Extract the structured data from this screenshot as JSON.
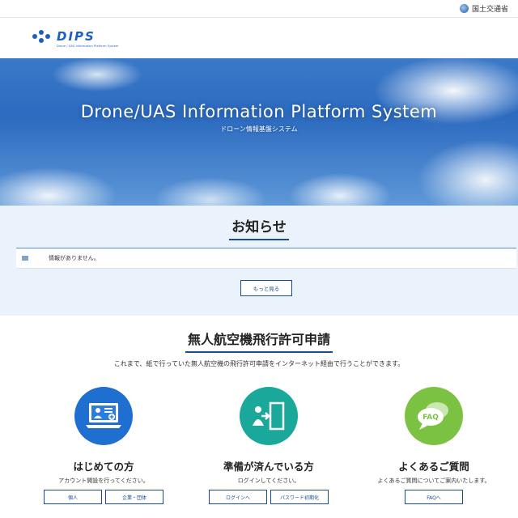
{
  "topbar": {
    "ministry_label": "国土交通省"
  },
  "logo": {
    "word": "DIPS",
    "subtitle": "Drone / UAS Information Platform System"
  },
  "hero": {
    "title": "Drone/UAS Information Platform System",
    "subtitle": "ドローン情報基盤システム"
  },
  "news": {
    "heading": "お知らせ",
    "items": [
      {
        "text": "情報がありません。"
      }
    ],
    "more_label": "もっと見る"
  },
  "apply": {
    "heading": "無人航空機飛行許可申請",
    "description": "これまで、紙で行っていた無人航空機の飛行許可申請をインターネット経由で行うことができます。"
  },
  "cards": [
    {
      "title": "はじめての方",
      "desc": "アカウント開設を行ってください。",
      "buttons": [
        "個人",
        "企業・団体"
      ],
      "color": "#1f6fd1"
    },
    {
      "title": "準備が済んでいる方",
      "desc": "ログインしてください。",
      "buttons": [
        "ログインへ",
        "パスワード初期化"
      ],
      "color": "#1aa89a"
    },
    {
      "title": "よくあるご質問",
      "desc": "よくあるご質問についてご案内いたします。",
      "buttons": [
        "FAQへ"
      ],
      "color": "#7cc242"
    }
  ],
  "faq_icon_text": "FAQ"
}
